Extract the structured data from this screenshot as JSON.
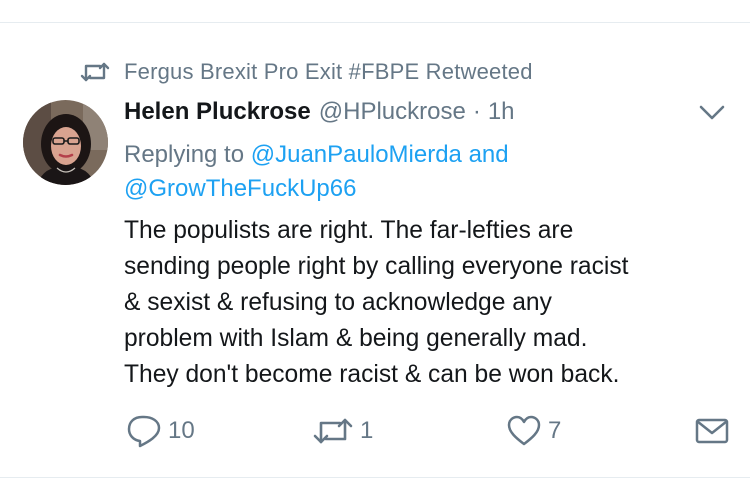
{
  "retweet_context": {
    "icon": "retweet-icon",
    "text": "Fergus Brexit Pro Exit #FBPE Retweeted"
  },
  "author": {
    "display_name": "Helen Pluckrose",
    "handle": "@HPluckrose",
    "separator": "·",
    "time": "1h",
    "avatar": "user-avatar-photo"
  },
  "reply_to": {
    "prefix": "Replying to",
    "mention_1": "@JuanPauloMierda",
    "conjunction": "and",
    "mention_2": "@GrowTheFuckUp66"
  },
  "tweet": {
    "lines": [
      "The populists are right. The far-lefties are",
      "sending people right by calling everyone racist",
      "& sexist & refusing to acknowledge any",
      "problem with Islam & being generally mad.",
      "They don't become racist & can be won back."
    ]
  },
  "actions": {
    "reply": {
      "icon": "reply-bubble-icon",
      "count": "10"
    },
    "retweet": {
      "icon": "retweet-icon",
      "count": "1"
    },
    "like": {
      "icon": "heart-icon",
      "count": "7"
    },
    "dm": {
      "icon": "envelope-icon"
    }
  },
  "colors": {
    "primary_text": "#14171a",
    "secondary_text": "#657786",
    "link": "#1da1f2",
    "divider": "#e6ecf0",
    "background": "#ffffff"
  }
}
